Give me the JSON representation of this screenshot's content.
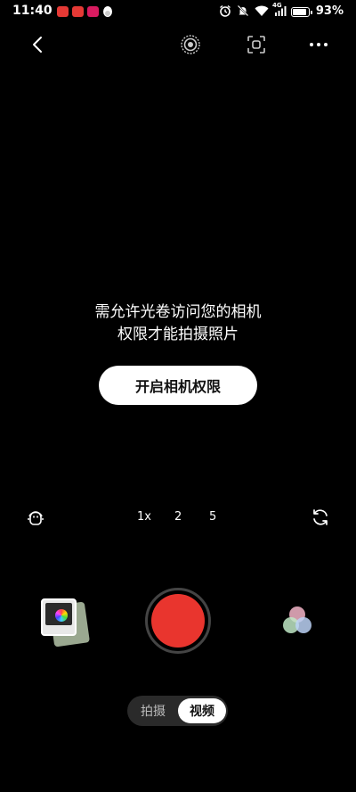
{
  "status_bar": {
    "time": "11:40",
    "network_label": "4G",
    "battery_percent": "93%",
    "battery_level": 0.93,
    "icons": [
      "app-notification-red-icon",
      "app-notification-red-icon",
      "app-notification-pink-icon",
      "qq-penguin-icon",
      "alarm-icon",
      "mute-icon",
      "wifi-icon",
      "signal-icon",
      "battery-icon"
    ]
  },
  "toolbar": {
    "icons": [
      "back-arrow-icon",
      "live-photo-icon",
      "scan-icon",
      "more-dots-icon"
    ]
  },
  "permission": {
    "message_line1": "需允许光卷访问您的相机",
    "message_line2": "权限才能拍摄照片",
    "button_label": "开启相机权限"
  },
  "zoom": {
    "options": [
      "1x",
      "2",
      "5"
    ]
  },
  "side_icons": [
    "face-beauty-icon",
    "camera-flip-icon"
  ],
  "bottom": {
    "gallery": "gallery-thumbnail",
    "shutter_color": "#e9352e",
    "filters": "filter-circles-icon"
  },
  "modes": {
    "photo": "拍摄",
    "video": "视频",
    "active": "video"
  }
}
